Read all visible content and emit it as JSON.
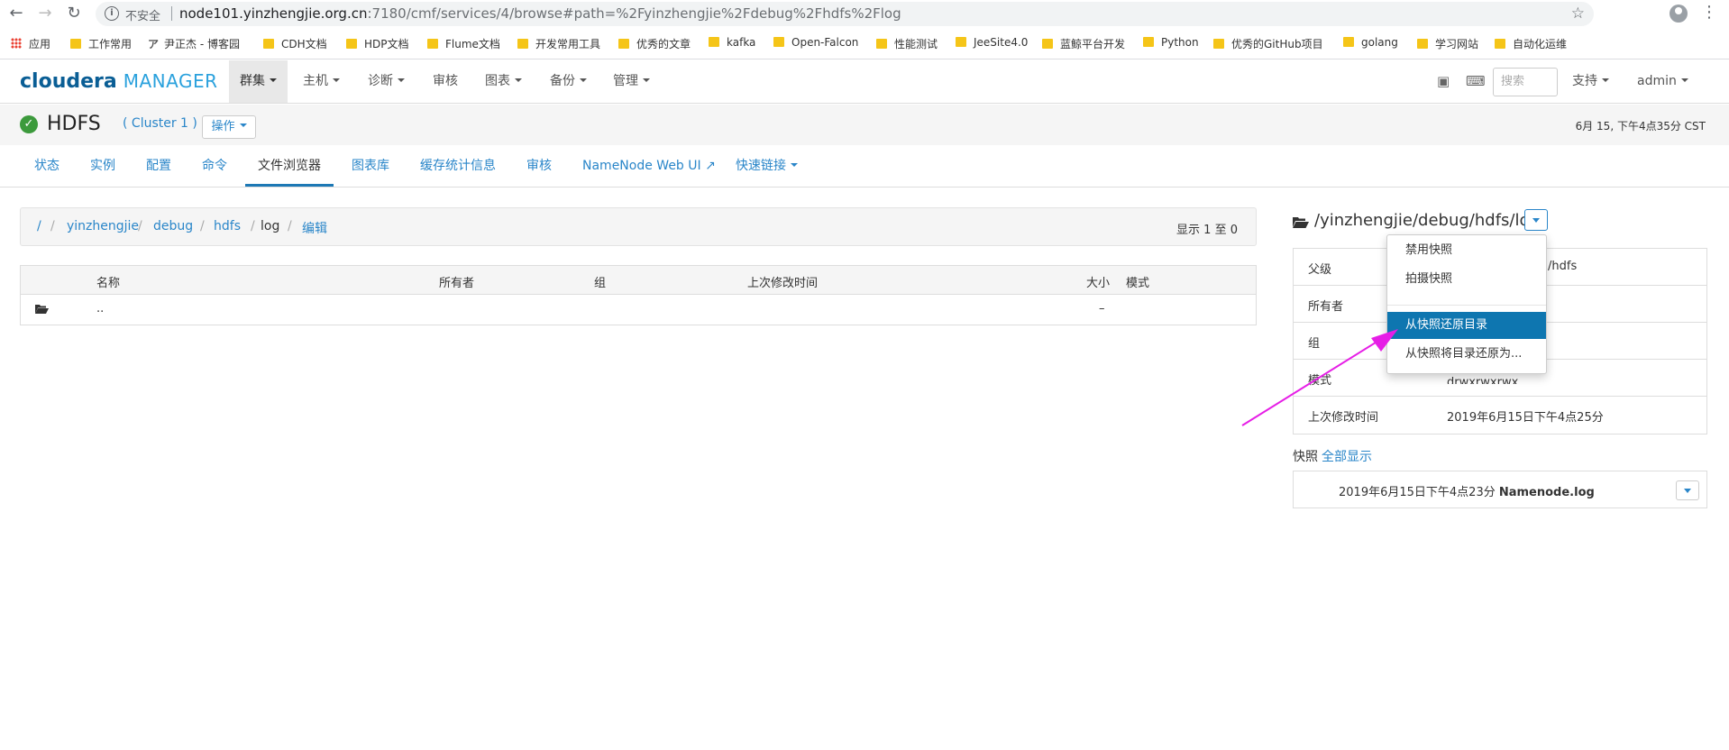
{
  "browser": {
    "insecure_label": "不安全",
    "url_host": "node101.yinzhengjie.org.cn",
    "url_rest": ":7180/cmf/services/4/browse#path=%2Fyinzhengjie%2Fdebug%2Fhdfs%2Flog"
  },
  "bookmarks": [
    "应用",
    "工作常用",
    "尹正杰 - 博客园",
    "CDH文档",
    "HDP文档",
    "Flume文档",
    "开发常用工具",
    "优秀的文章",
    "kafka",
    "Open-Falcon",
    "性能测试",
    "JeeSite4.0",
    "蓝鲸平台开发",
    "Python",
    "优秀的GitHub项目",
    "golang",
    "学习网站",
    "自动化运维"
  ],
  "nav": {
    "logo_bold": "cloudera",
    "logo_light": "MANAGER",
    "menus": [
      "群集",
      "主机",
      "诊断",
      "审核",
      "图表",
      "备份",
      "管理"
    ],
    "search_placeholder": "搜索",
    "support": "支持",
    "user": "admin"
  },
  "service": {
    "name": "HDFS",
    "cluster": "( Cluster 1 )",
    "actions": "操作",
    "time": "6月 15, 下午4点35分 CST"
  },
  "tabs": [
    "状态",
    "实例",
    "配置",
    "命令",
    "文件浏览器",
    "图表库",
    "缓存统计信息",
    "审核",
    "NameNode Web UI",
    "快速链接"
  ],
  "breadcrumb": {
    "root": "/",
    "parts": [
      "yinzhengjie",
      "debug",
      "hdfs",
      "log"
    ],
    "edit": "编辑",
    "count": "显示 1 至 0"
  },
  "table": {
    "headers": [
      "名称",
      "所有者",
      "组",
      "上次修改时间",
      "大小",
      "模式"
    ],
    "rows": [
      {
        "name": "..",
        "size": "–"
      }
    ]
  },
  "panel": {
    "path": "/yinzhengjie/debug/hdfs/log",
    "props": [
      {
        "key": "父级",
        "value": "/hdfs"
      },
      {
        "key": "所有者",
        "value": ""
      },
      {
        "key": "组",
        "value": ""
      },
      {
        "key": "模式",
        "value": "drwxrwxrwx"
      },
      {
        "key": "上次修改时间",
        "value": "2019年6月15日下午4点25分"
      }
    ],
    "snap_label": "快照",
    "snap_all": "全部显示",
    "snap_time": "2019年6月15日下午4点23分",
    "snap_name": "Namenode.log"
  },
  "dropdown": {
    "items": [
      "禁用快照",
      "拍摄快照",
      "从快照还原目录",
      "从快照将目录还原为..."
    ],
    "active_index": 2
  },
  "colors": {
    "accent": "#0e76b0",
    "link": "#2a86c9",
    "arrow": "#e61ee6",
    "ok": "#3c9a3c"
  }
}
